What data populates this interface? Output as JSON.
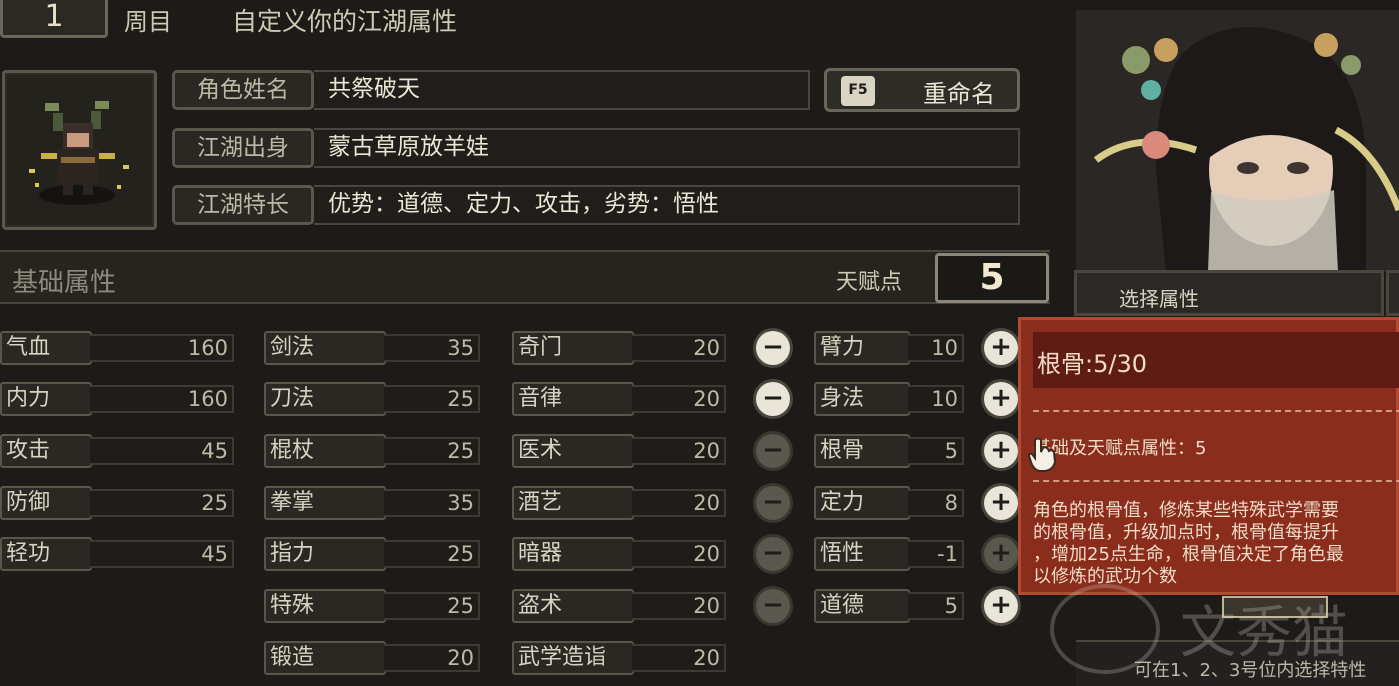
{
  "header": {
    "cycle_number": "1",
    "cycle_label": "周目",
    "title": "自定义你的江湖属性"
  },
  "profile": {
    "name_label": "角色姓名",
    "name_value": "共祭破天",
    "origin_label": "江湖出身",
    "origin_value": "蒙古草原放羊娃",
    "specialty_label": "江湖特长",
    "specialty_value": "优势：道德、定力、攻击，劣势：悟性",
    "rename_key": "F5",
    "rename_label": "重命名"
  },
  "attributes_bar": {
    "label": "基础属性",
    "talent_label": "天赋点",
    "talent_points": "5"
  },
  "col1": [
    {
      "name": "气血",
      "value": "160"
    },
    {
      "name": "内力",
      "value": "160"
    },
    {
      "name": "攻击",
      "value": "45"
    },
    {
      "name": "防御",
      "value": "25"
    },
    {
      "name": "轻功",
      "value": "45"
    }
  ],
  "col2": [
    {
      "name": "剑法",
      "value": "35"
    },
    {
      "name": "刀法",
      "value": "25"
    },
    {
      "name": "棍杖",
      "value": "25"
    },
    {
      "name": "拳掌",
      "value": "35"
    },
    {
      "name": "指力",
      "value": "25"
    },
    {
      "name": "特殊",
      "value": "25"
    },
    {
      "name": "锻造",
      "value": "20"
    }
  ],
  "col3": [
    {
      "name": "奇门",
      "value": "20"
    },
    {
      "name": "音律",
      "value": "20"
    },
    {
      "name": "医术",
      "value": "20"
    },
    {
      "name": "酒艺",
      "value": "20"
    },
    {
      "name": "暗器",
      "value": "20"
    },
    {
      "name": "盗术",
      "value": "20"
    },
    {
      "name": "武学造诣",
      "value": "20"
    }
  ],
  "talents": [
    {
      "name": "臂力",
      "value": "10",
      "minus_enabled": true,
      "plus_enabled": true
    },
    {
      "name": "身法",
      "value": "10",
      "minus_enabled": true,
      "plus_enabled": true
    },
    {
      "name": "根骨",
      "value": "5",
      "minus_enabled": false,
      "plus_enabled": true
    },
    {
      "name": "定力",
      "value": "8",
      "minus_enabled": false,
      "plus_enabled": true
    },
    {
      "name": "悟性",
      "value": "-1",
      "minus_enabled": false,
      "plus_enabled": false
    },
    {
      "name": "道德",
      "value": "5",
      "minus_enabled": false,
      "plus_enabled": true
    }
  ],
  "buttons": {
    "minus_glyph": "−",
    "plus_glyph": "+"
  },
  "right_panel": {
    "select_label": "选择属性",
    "footer_text": "可在1、2、3号位内选择特性"
  },
  "tooltip": {
    "title": "根骨:5/30",
    "base_line": "基础及天赋点属性：5",
    "desc_lines": [
      "角色的根骨值，修炼某些特殊武学需要",
      "的根骨值，升级加点时，根骨值每提升",
      "，增加25点生命，根骨值决定了角色最",
      "以修炼的武功个数"
    ]
  },
  "watermark": "文秀猫",
  "colors": {
    "background": "#1d1b17",
    "tooltip_bg": "#8a2d1c",
    "button_light": "#e9e5d8",
    "button_dim": "#5a574e"
  }
}
